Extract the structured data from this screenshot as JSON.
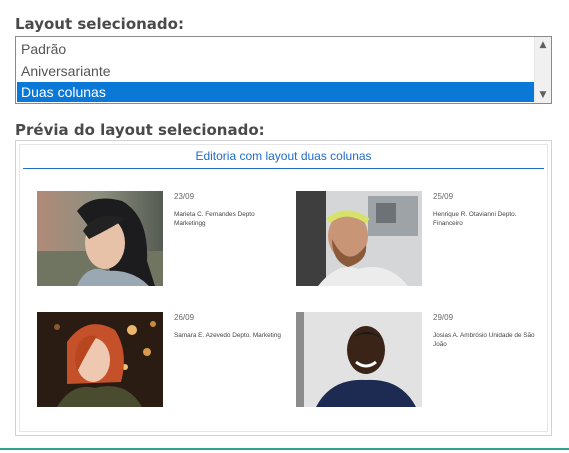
{
  "labels": {
    "layout": "Layout selecionado:",
    "preview": "Prévia do layout selecionado:"
  },
  "layout_options": [
    {
      "label": "Padrão",
      "selected": false
    },
    {
      "label": "Aniversariante",
      "selected": false
    },
    {
      "label": "Duas colunas",
      "selected": true
    }
  ],
  "preview": {
    "title": "Editoria com layout duas colunas",
    "cards": [
      {
        "date": "23/09",
        "name": "Marieta C. Fernandes Depto Marketingg"
      },
      {
        "date": "25/09",
        "name": "Henrique R. Otavianni Depto. Financeiro"
      },
      {
        "date": "26/09",
        "name": "Samara E. Azevedo Depto. Marketing"
      },
      {
        "date": "29/09",
        "name": "Josias A. Ambrósio Unidade de São João"
      }
    ]
  },
  "colors": {
    "selection": "#0a78d7",
    "accent": "#1f6bc7",
    "bottom_rule": "#2fa38a"
  },
  "icons": [
    "scroll-up-arrow-icon",
    "scroll-down-arrow-icon"
  ]
}
